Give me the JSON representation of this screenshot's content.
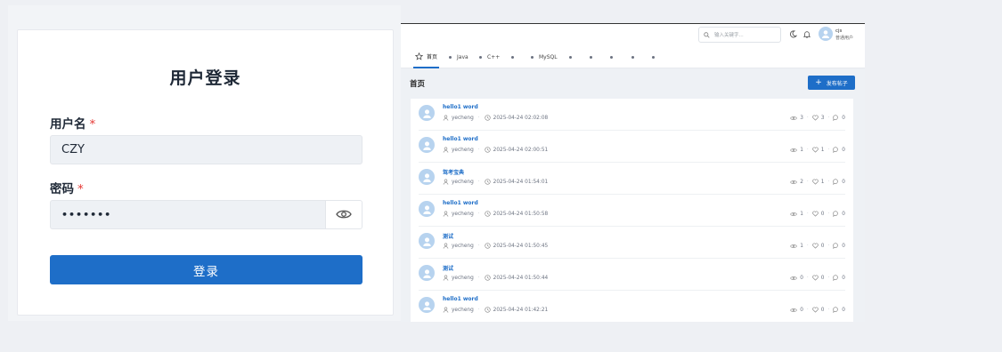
{
  "login": {
    "title": "用户登录",
    "username_label": "用户名",
    "username_value": "CZY",
    "password_label": "密码",
    "required_mark": "*",
    "password_masked": "•••••••",
    "submit_label": "登录"
  },
  "forum": {
    "search_placeholder": "输入关键字...",
    "user": {
      "name": "cjs",
      "role": "普通用户"
    },
    "tabs": [
      {
        "icon": "star-icon",
        "label": "首页"
      },
      {
        "icon": "dot",
        "label": "Java"
      },
      {
        "icon": "dot",
        "label": "C++"
      },
      {
        "icon": "dot",
        "label": ""
      },
      {
        "icon": "dot",
        "label": "MySQL"
      },
      {
        "icon": "dot",
        "label": ""
      },
      {
        "icon": "dot",
        "label": ""
      },
      {
        "icon": "dot",
        "label": ""
      },
      {
        "icon": "dot",
        "label": ""
      },
      {
        "icon": "dot",
        "label": ""
      }
    ],
    "page_title": "首页",
    "post_button": "发布帖子",
    "posts": [
      {
        "title": "hello1 word",
        "author": "yecheng",
        "time": "2025-04-24 02:02:08",
        "views": "3",
        "likes": "3",
        "comments": "0"
      },
      {
        "title": "hello1 word",
        "author": "yecheng",
        "time": "2025-04-24 02:00:51",
        "views": "1",
        "likes": "1",
        "comments": "0"
      },
      {
        "title": "驾考宝典",
        "author": "yecheng",
        "time": "2025-04-24 01:54:01",
        "views": "2",
        "likes": "1",
        "comments": "0"
      },
      {
        "title": "hello1 word",
        "author": "yecheng",
        "time": "2025-04-24 01:50:58",
        "views": "1",
        "likes": "0",
        "comments": "0"
      },
      {
        "title": "测试",
        "author": "yecheng",
        "time": "2025-04-24 01:50:45",
        "views": "1",
        "likes": "0",
        "comments": "0"
      },
      {
        "title": "测试",
        "author": "yecheng",
        "time": "2025-04-24 01:50:44",
        "views": "0",
        "likes": "0",
        "comments": "0"
      },
      {
        "title": "hello1 word",
        "author": "yecheng",
        "time": "2025-04-24 01:42:21",
        "views": "0",
        "likes": "0",
        "comments": "0"
      }
    ]
  },
  "colors": {
    "primary": "#1e6ec8",
    "required": "#e53935",
    "avatar": "#b7d3ef"
  }
}
